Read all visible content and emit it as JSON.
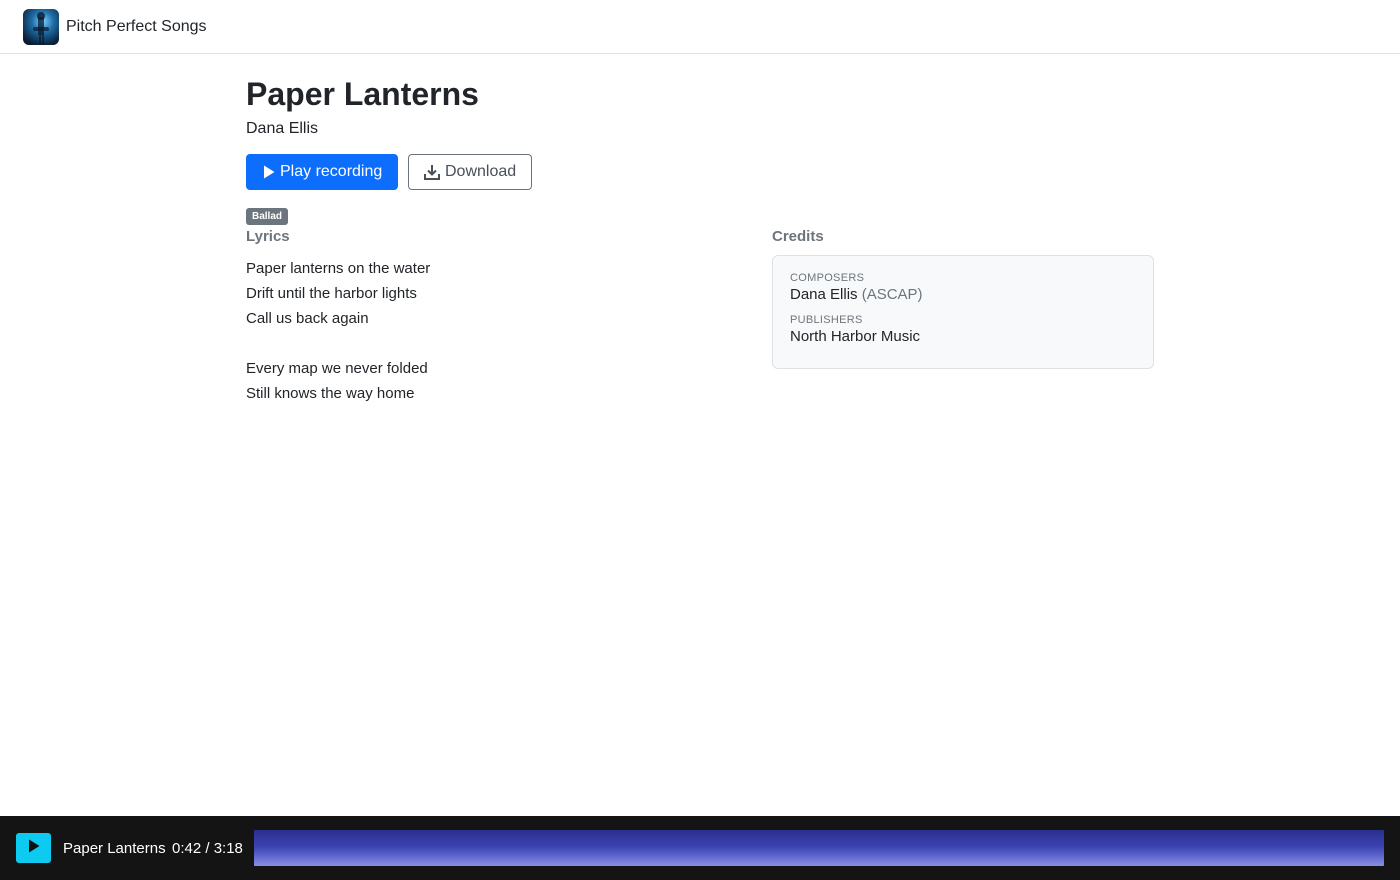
{
  "app": {
    "brand_name": "Pitch Perfect Songs",
    "logo_icon": "guitarist-photo-icon"
  },
  "song": {
    "title": "Paper Lanterns",
    "artist": "Dana Ellis",
    "genre_badge": "Ballad"
  },
  "actions": {
    "play_label": "Play recording",
    "play_icon": "play-icon",
    "download_label": "Download",
    "download_icon": "download-icon"
  },
  "lyrics": {
    "heading": "Lyrics",
    "stanzas": [
      [
        "Paper lanterns on the water",
        "Drift until the harbor lights",
        "Call us back again"
      ],
      [
        "Every map we never folded",
        "Still knows the way home"
      ]
    ]
  },
  "credits": {
    "heading": "Credits",
    "composers_label": "Composers",
    "composer_name": "Dana Ellis",
    "composer_pro": "(ASCAP)",
    "publishers_label": "Publishers",
    "publisher_name": "North Harbor Music"
  },
  "player": {
    "title": "Paper Lanterns",
    "time_display": "0:42 / 3:18",
    "elapsed_seconds": 42,
    "duration_seconds": 198,
    "play_icon": "play-icon"
  },
  "colors": {
    "primary": "#0d6efd",
    "secondary": "#6c757d",
    "player_bg": "#141414",
    "player_button": "#0dcaf0",
    "waveform": "#3b42b0"
  }
}
